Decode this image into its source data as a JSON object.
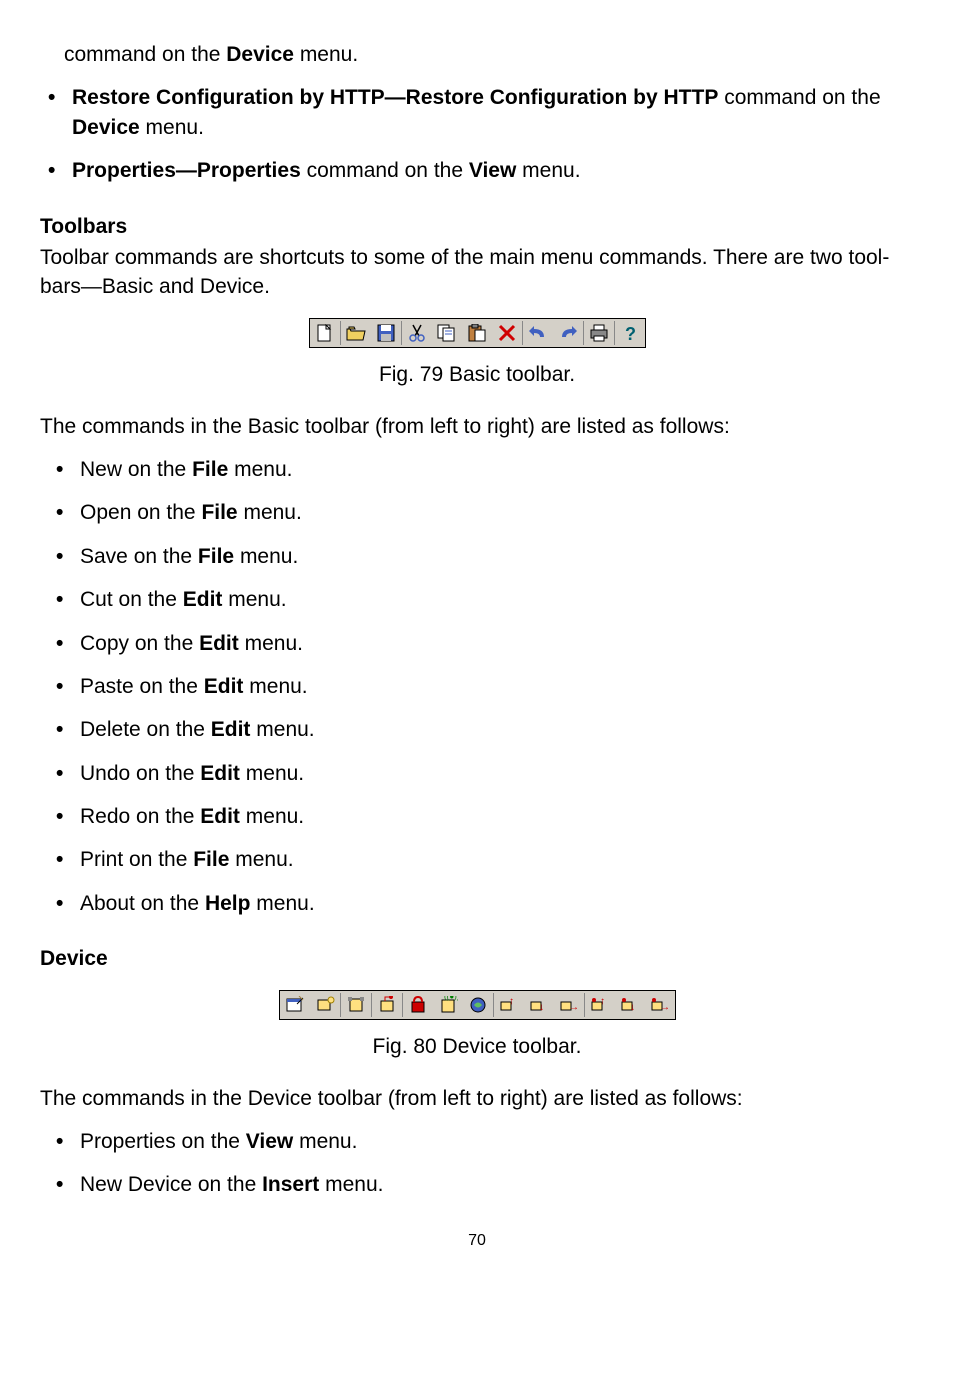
{
  "intro_continuation": {
    "pre": "command on the ",
    "bold": "Device",
    "post": " menu."
  },
  "bullets_top": [
    {
      "b1": "Restore Configuration by HTTP—Restore Configuration by HTTP",
      "mid1": " command on the ",
      "b2": "Device",
      "post": " menu."
    },
    {
      "b1": "Properties—Properties",
      "mid1": " command on the ",
      "b2": "View",
      "post": " menu."
    }
  ],
  "toolbars_heading": "Toolbars",
  "toolbars_para": "Toolbar commands are shortcuts to some of the main menu commands. There are two tool-bars—Basic and Device.",
  "fig79": "Fig. 79 Basic toolbar.",
  "basic_intro": "The commands in the Basic toolbar (from left to right) are listed as follows:",
  "basic_list": [
    {
      "pre": "New on the ",
      "b": "File",
      "post": " menu."
    },
    {
      "pre": "Open on the ",
      "b": "File",
      "post": " menu."
    },
    {
      "pre": "Save on the ",
      "b": "File",
      "post": " menu."
    },
    {
      "pre": "Cut on the ",
      "b": "Edit",
      "post": " menu."
    },
    {
      "pre": "Copy on the ",
      "b": "Edit",
      "post": " menu."
    },
    {
      "pre": "Paste on the ",
      "b": "Edit",
      "post": " menu."
    },
    {
      "pre": "Delete on the ",
      "b": "Edit",
      "post": " menu."
    },
    {
      "pre": "Undo on the ",
      "b": "Edit",
      "post": " menu."
    },
    {
      "pre": "Redo on the ",
      "b": "Edit",
      "post": " menu."
    },
    {
      "pre": "Print on the ",
      "b": "File",
      "post": " menu."
    },
    {
      "pre": "About on the ",
      "b": "Help",
      "post": " menu."
    }
  ],
  "device_heading": "Device",
  "fig80": "Fig. 80 Device toolbar.",
  "device_intro": "The commands in the Device toolbar (from left to right) are listed as follows:",
  "device_list": [
    {
      "pre": "Properties on the ",
      "b": "View",
      "post": " menu."
    },
    {
      "pre": "New Device on the ",
      "b": "Insert",
      "post": " menu."
    }
  ],
  "page_number": "70"
}
